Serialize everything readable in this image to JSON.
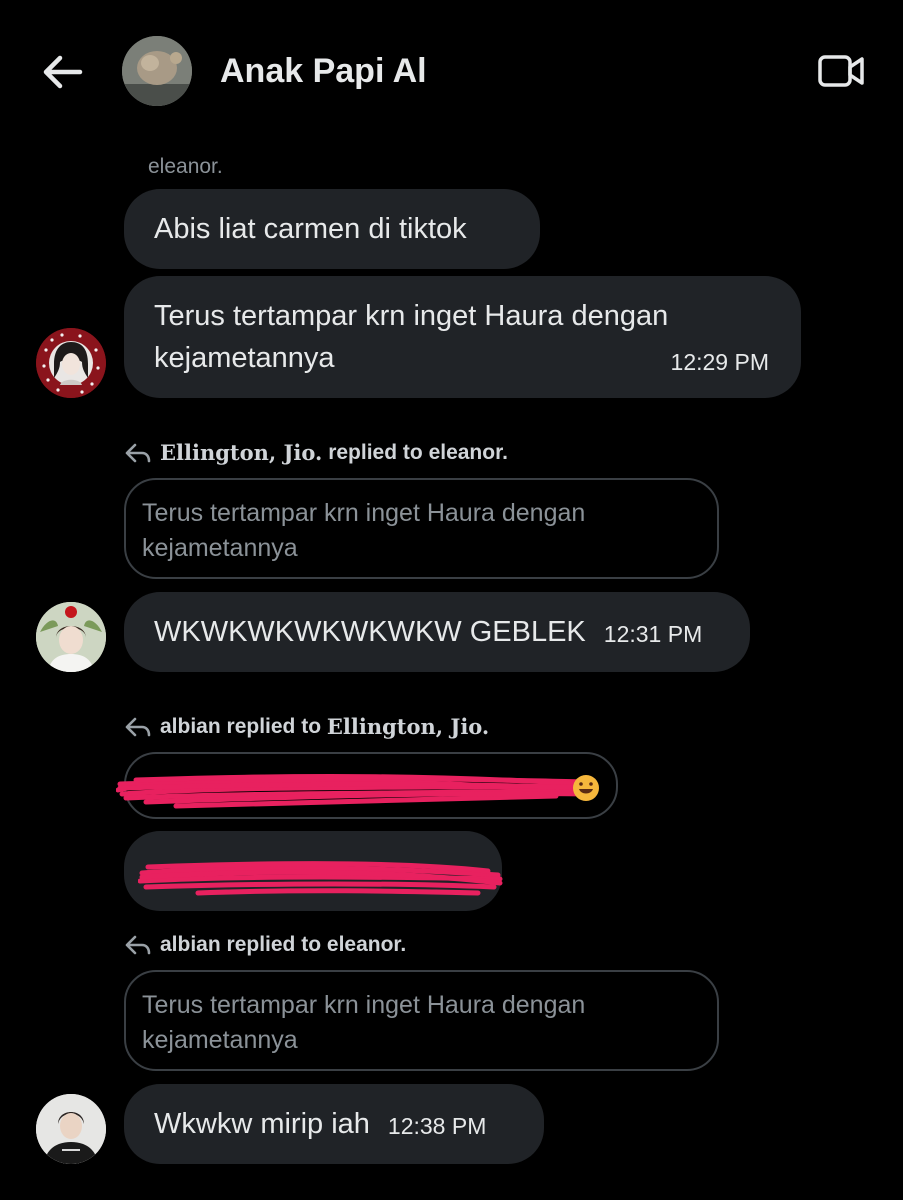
{
  "header": {
    "title": "Anak Papi Al",
    "back_icon": "arrow-left-icon",
    "video_icon": "video-camera-icon"
  },
  "messages": [
    {
      "sender": "eleanor.",
      "text": "Abis liat carmen di tiktok"
    },
    {
      "text": "Terus tertampar krn inget Haura dengan kejametannya",
      "time": "12:29 PM"
    },
    {
      "reply_name": "Ellington, Jio.",
      "reply_action": "replied to",
      "reply_target": "eleanor.",
      "quote": "Terus tertampar krn inget Haura dengan kejametannya",
      "text": "WKWKWKWKWKWKW GEBLEK",
      "time": "12:31 PM"
    },
    {
      "reply_name": "albian",
      "reply_action": "replied to",
      "reply_target": "Ellington, Jio."
    },
    {
      "reply_name": "albian",
      "reply_action": "replied to",
      "reply_target": "eleanor.",
      "quote": "Terus tertampar krn inget Haura dengan kejametannya",
      "text": "Wkwkw mirip iah",
      "time": "12:38 PM"
    }
  ],
  "colors": {
    "background": "#000000",
    "bubble": "#202327",
    "redaction": "#e8215f",
    "muted_text": "#8b9298"
  }
}
